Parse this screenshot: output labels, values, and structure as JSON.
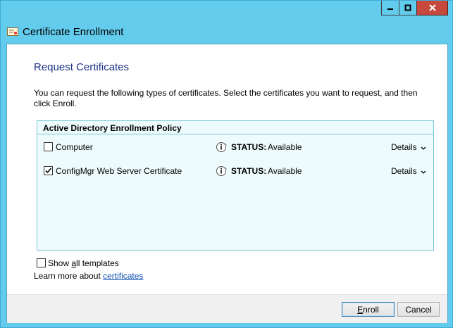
{
  "window": {
    "title": "Certificate Enrollment",
    "minimize_glyph": "—",
    "maximize_glyph": "□",
    "close_glyph": "✕",
    "title_icon": "certificate-icon"
  },
  "page": {
    "heading": "Request Certificates",
    "description": "You can request the following types of certificates. Select the certificates you want to request, and then click Enroll."
  },
  "policy": {
    "title": "Active Directory Enrollment Policy",
    "items": [
      {
        "label": "Computer",
        "checked": false,
        "status_label": "STATUS:",
        "status_value": "Available",
        "details_label": "Details"
      },
      {
        "label": "ConfigMgr Web Server Certificate",
        "checked": true,
        "status_label": "STATUS:",
        "status_value": "Available",
        "details_label": "Details"
      }
    ]
  },
  "options": {
    "show_all_pre": "Show ",
    "show_all_u": "a",
    "show_all_post": "ll templates",
    "learn_more_text": "Learn more about ",
    "learn_more_link": "certificates"
  },
  "buttons": {
    "enroll_u": "E",
    "enroll_rest": "nroll",
    "cancel": "Cancel"
  }
}
